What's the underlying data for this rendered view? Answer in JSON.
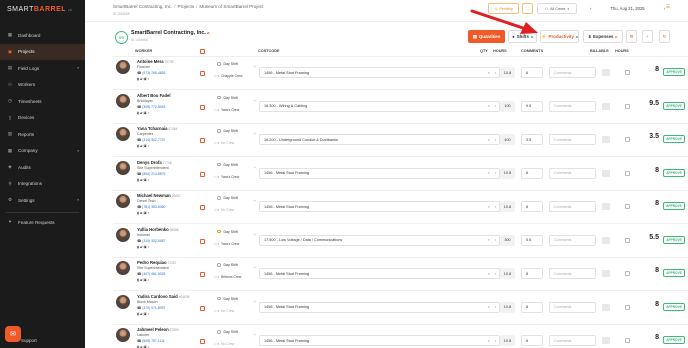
{
  "app": {
    "logo_main": "SMART",
    "logo_accent": "BARREL",
    "version": "v6"
  },
  "sidebar": {
    "items": [
      {
        "label": "Dashboard",
        "icon": "grid-icon"
      },
      {
        "label": "Projects",
        "icon": "briefcase-icon",
        "active": true
      },
      {
        "label": "Field Logs",
        "icon": "clipboard-icon",
        "chevron": true
      },
      {
        "label": "Workers",
        "icon": "users-icon"
      },
      {
        "label": "Timesheets",
        "icon": "clock-icon"
      },
      {
        "label": "Devices",
        "icon": "device-icon"
      },
      {
        "label": "Reports",
        "icon": "chart-icon"
      },
      {
        "label": "Company",
        "icon": "building-icon",
        "chevron": true
      },
      {
        "label": "Audits",
        "icon": "shield-icon"
      },
      {
        "label": "Integrations",
        "icon": "plug-icon"
      },
      {
        "label": "Settings",
        "icon": "gear-icon",
        "chevron": true
      }
    ],
    "feature_requests": "Feature Requests",
    "support": "Support"
  },
  "topbar": {
    "crumbs": [
      "SmartBarrel Contracting, Inc.",
      "Projects",
      "Museum of SmartBarrel Project"
    ],
    "sub_id": "ID 1024568",
    "pending": "Pending",
    "crews": "All Crews",
    "date": "Thu, Aug 21, 2025"
  },
  "header": {
    "project_num": "56",
    "contractor": "SmartBarrel Contracting, Inc.",
    "contractor_id": "ID 1024568"
  },
  "tabs": {
    "quantities": "Quantities",
    "shifts": "Shifts",
    "productivity": "Productivity",
    "expenses": "Expenses"
  },
  "columns": {
    "worker": "WORKER",
    "costcode": "COSTCODE",
    "qty": "QTY",
    "hours": "HOURS",
    "comments": "COMMENTS",
    "billable": "BILLABLE",
    "hours2": "HOURS"
  },
  "rows": [
    {
      "name": "Antoine Mera",
      "id": "70709",
      "role": "Finisher",
      "phone": "(973) 765-4653",
      "shift": "Day Shift",
      "crew": "Chapple Crew",
      "code": "1456 - Metal Stud Framing",
      "qty": "10.8",
      "hours": "8",
      "comment": "Comments",
      "total": "8",
      "approve": "APPROVE"
    },
    {
      "name": "Albert Bou Fadel",
      "id": "",
      "role": "Bricklayer",
      "phone": "(309) 772-5453",
      "shift": "Day Shift",
      "crew": "Yara's Crew",
      "code": "16.300 - Wiring & Cabling",
      "qty": "100",
      "hours": "9.5",
      "comment": "Comments",
      "total": "9.5",
      "approve": "APPROVE"
    },
    {
      "name": "Yana Tcharnaia",
      "id": "47454",
      "role": "Carpenter",
      "phone": "(414) 302-7737",
      "shift": "Day Shift",
      "crew": "No Crew",
      "code": "16.200 - Underground Conduit & Ductbanks",
      "qty": "400",
      "hours": "3.5",
      "comment": "Comments",
      "total": "3.5",
      "approve": "APPROVE"
    },
    {
      "name": "Denys Drofa",
      "id": "27708",
      "role": "Site Superintendent",
      "phone": "(894) 214-6879",
      "shift": "Day Shift",
      "crew": "Yara's Crew",
      "code": "1456 - Metal Stud Framing",
      "qty": "10.8",
      "hours": "8",
      "comment": "Comments",
      "total": "8",
      "approve": "APPROVE"
    },
    {
      "name": "Michael Newman",
      "id": "26667",
      "role": "Diesel Tech",
      "phone": "(781) 383-6060",
      "shift": "Day Shift",
      "crew": "No Crew",
      "code": "1456 - Metal Stud Framing",
      "qty": "10.8",
      "hours": "8",
      "comment": "Comments",
      "total": "8",
      "approve": "APPROVE"
    },
    {
      "name": "Yullia Horbenko",
      "id": "98086",
      "role": "Ironman",
      "phone": "(310) 302-5487",
      "shift": "Day Shift",
      "crew": "Yara's Crew",
      "code": "17.500 - Low Voltage / Data / Communications",
      "qty": "300",
      "hours": "5.5",
      "comment": "Comments",
      "total": "5.5",
      "approve": "APPROVE",
      "alert": true
    },
    {
      "name": "Pedro Requiao",
      "id": "72267",
      "role": "Site Superintendent",
      "phone": "(407) 461-0025",
      "shift": "Day Shift",
      "crew": "Brittons Crew",
      "code": "1456 - Metal Stud Framing",
      "qty": "10.8",
      "hours": "8",
      "comment": "Comments",
      "total": "8",
      "approve": "APPROVE"
    },
    {
      "name": "Yadira Cardoso Said",
      "id": "404636",
      "role": "Block Mason",
      "phone": "(470) 971-8097",
      "shift": "Day Shift",
      "crew": "No Crew",
      "code": "1456 - Metal Stud Framing",
      "qty": "10.8",
      "hours": "8",
      "comment": "Comments",
      "total": "8",
      "approve": "APPROVE"
    },
    {
      "name": "Jahmeel Peleon",
      "id": "67809",
      "role": "Laborer",
      "phone": "(609) 757-1111",
      "shift": "Day Shift",
      "crew": "No Crew",
      "code": "1456 - Metal Stud Framing",
      "qty": "10.8",
      "hours": "8",
      "comment": "Comments",
      "total": "8",
      "approve": "APPROVE"
    }
  ],
  "colors": {
    "accent": "#f05a28",
    "green": "#3cb878",
    "sidebar": "#1b1b1b",
    "arrow": "#e02020"
  }
}
